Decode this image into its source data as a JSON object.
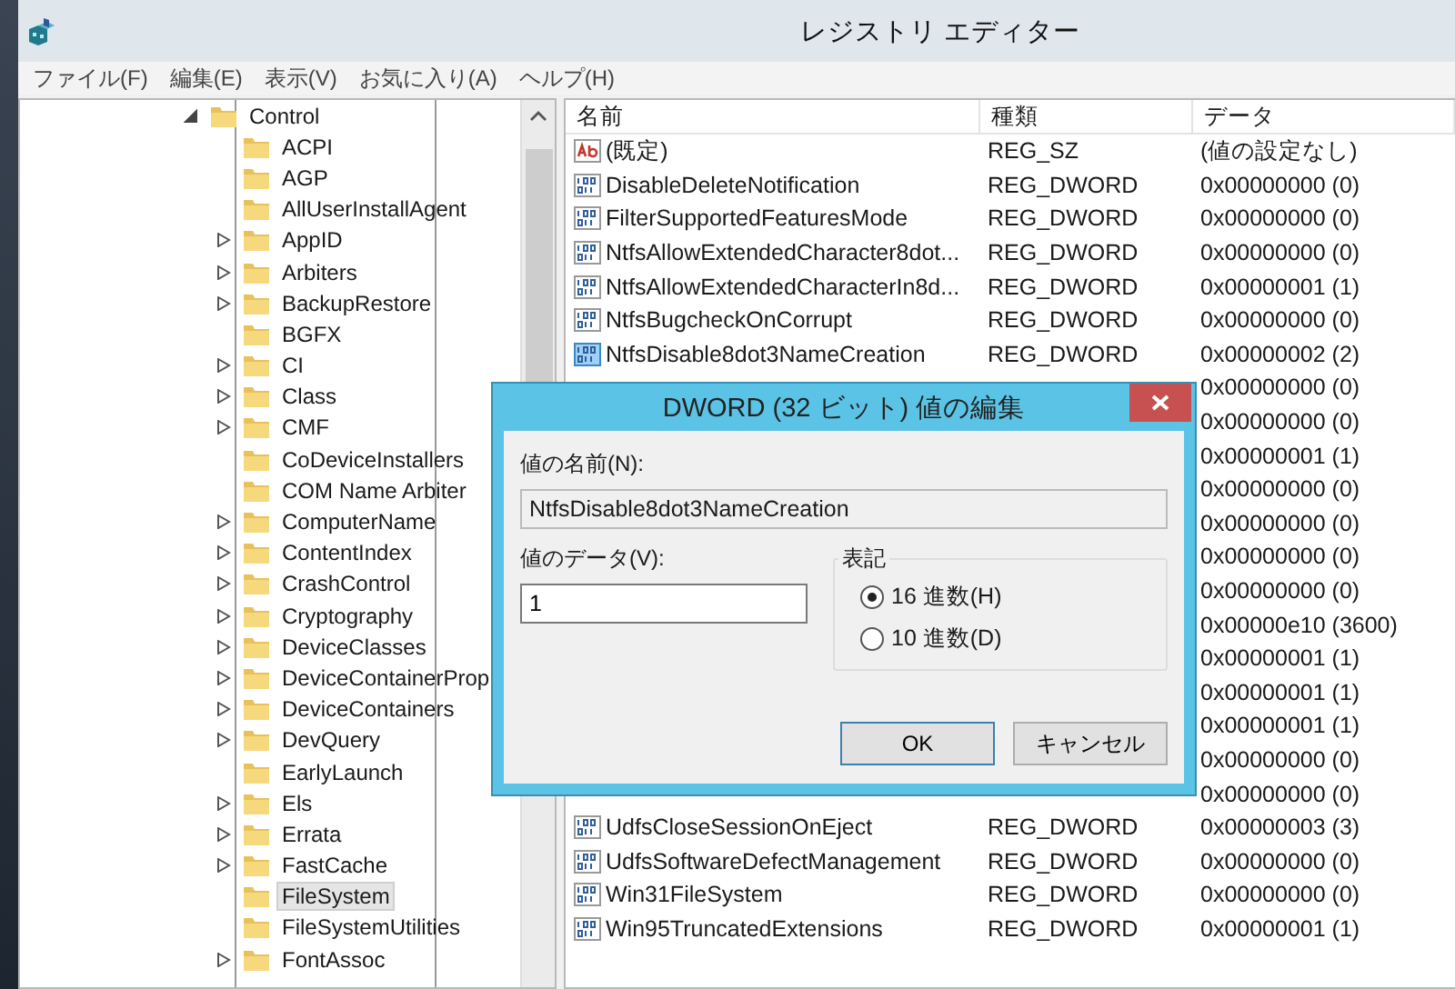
{
  "window": {
    "title": "レジストリ エディター"
  },
  "menu": [
    "ファイル(F)",
    "編集(E)",
    "表示(V)",
    "お気に入り(A)",
    "ヘルプ(H)"
  ],
  "tree": {
    "items": [
      {
        "label": "Control",
        "has_children": true,
        "expanded": true,
        "selected": false,
        "children": [
          {
            "label": "ACPI",
            "has_children": false,
            "expanded": false,
            "selected": false
          },
          {
            "label": "AGP",
            "has_children": false,
            "expanded": false,
            "selected": false
          },
          {
            "label": "AllUserInstallAgent",
            "has_children": false,
            "expanded": false,
            "selected": false
          },
          {
            "label": "AppID",
            "has_children": true,
            "expanded": false,
            "selected": false
          },
          {
            "label": "Arbiters",
            "has_children": true,
            "expanded": false,
            "selected": false
          },
          {
            "label": "BackupRestore",
            "has_children": true,
            "expanded": false,
            "selected": false
          },
          {
            "label": "BGFX",
            "has_children": false,
            "expanded": false,
            "selected": false
          },
          {
            "label": "CI",
            "has_children": true,
            "expanded": false,
            "selected": false
          },
          {
            "label": "Class",
            "has_children": true,
            "expanded": false,
            "selected": false
          },
          {
            "label": "CMF",
            "has_children": true,
            "expanded": false,
            "selected": false
          },
          {
            "label": "CoDeviceInstallers",
            "has_children": false,
            "expanded": false,
            "selected": false
          },
          {
            "label": "COM Name Arbiter",
            "has_children": false,
            "expanded": false,
            "selected": false
          },
          {
            "label": "ComputerName",
            "has_children": true,
            "expanded": false,
            "selected": false
          },
          {
            "label": "ContentIndex",
            "has_children": true,
            "expanded": false,
            "selected": false
          },
          {
            "label": "CrashControl",
            "has_children": true,
            "expanded": false,
            "selected": false
          },
          {
            "label": "Cryptography",
            "has_children": true,
            "expanded": false,
            "selected": false
          },
          {
            "label": "DeviceClasses",
            "has_children": true,
            "expanded": false,
            "selected": false
          },
          {
            "label": "DeviceContainerProp",
            "has_children": true,
            "expanded": false,
            "selected": false
          },
          {
            "label": "DeviceContainers",
            "has_children": true,
            "expanded": false,
            "selected": false
          },
          {
            "label": "DevQuery",
            "has_children": true,
            "expanded": false,
            "selected": false
          },
          {
            "label": "EarlyLaunch",
            "has_children": false,
            "expanded": false,
            "selected": false
          },
          {
            "label": "Els",
            "has_children": true,
            "expanded": false,
            "selected": false
          },
          {
            "label": "Errata",
            "has_children": true,
            "expanded": false,
            "selected": false
          },
          {
            "label": "FastCache",
            "has_children": true,
            "expanded": false,
            "selected": false
          },
          {
            "label": "FileSystem",
            "has_children": false,
            "expanded": false,
            "selected": true
          },
          {
            "label": "FileSystemUtilities",
            "has_children": false,
            "expanded": false,
            "selected": false
          },
          {
            "label": "FontAssoc",
            "has_children": true,
            "expanded": false,
            "selected": false
          }
        ]
      }
    ]
  },
  "table": {
    "columns": [
      "名前",
      "種類",
      "データ"
    ],
    "rows": [
      {
        "kind": "string",
        "name": "(既定)",
        "type": "REG_SZ",
        "data": "(値の設定なし)",
        "selected": false
      },
      {
        "kind": "dword",
        "name": "DisableDeleteNotification",
        "type": "REG_DWORD",
        "data": "0x00000000 (0)",
        "selected": false
      },
      {
        "kind": "dword",
        "name": "FilterSupportedFeaturesMode",
        "type": "REG_DWORD",
        "data": "0x00000000 (0)",
        "selected": false
      },
      {
        "kind": "dword",
        "name": "NtfsAllowExtendedCharacter8dot...",
        "type": "REG_DWORD",
        "data": "0x00000000 (0)",
        "selected": false
      },
      {
        "kind": "dword",
        "name": "NtfsAllowExtendedCharacterIn8d...",
        "type": "REG_DWORD",
        "data": "0x00000001 (1)",
        "selected": false
      },
      {
        "kind": "dword",
        "name": "NtfsBugcheckOnCorrupt",
        "type": "REG_DWORD",
        "data": "0x00000000 (0)",
        "selected": false
      },
      {
        "kind": "dword",
        "name": "NtfsDisable8dot3NameCreation",
        "type": "REG_DWORD",
        "data": "0x00000002 (2)",
        "selected": true
      },
      {
        "data": "0x00000000 (0)"
      },
      {
        "data": "0x00000000 (0)"
      },
      {
        "data": "0x00000001 (1)"
      },
      {
        "data": "0x00000000 (0)"
      },
      {
        "data": "0x00000000 (0)"
      },
      {
        "data": "0x00000000 (0)"
      },
      {
        "data": "0x00000000 (0)"
      },
      {
        "data": "0x00000e10 (3600)"
      },
      {
        "data": "0x00000001 (1)"
      },
      {
        "data": "0x00000001 (1)"
      },
      {
        "data": "0x00000001 (1)"
      },
      {
        "data": "0x00000000 (0)"
      },
      {
        "data": "0x00000000 (0)"
      },
      {
        "kind": "dword",
        "name": "UdfsCloseSessionOnEject",
        "type": "REG_DWORD",
        "data": "0x00000003 (3)",
        "selected": false
      },
      {
        "kind": "dword",
        "name": "UdfsSoftwareDefectManagement",
        "type": "REG_DWORD",
        "data": "0x00000000 (0)",
        "selected": false
      },
      {
        "kind": "dword",
        "name": "Win31FileSystem",
        "type": "REG_DWORD",
        "data": "0x00000000 (0)",
        "selected": false
      },
      {
        "kind": "dword",
        "name": "Win95TruncatedExtensions",
        "type": "REG_DWORD",
        "data": "0x00000001 (1)",
        "selected": false
      }
    ]
  },
  "dialog": {
    "title": "DWORD (32 ビット) 値の編集",
    "name_label": "値の名前(N):",
    "name_value": "NtfsDisable8dot3NameCreation",
    "data_label": "値のデータ(V):",
    "data_value": "1",
    "group_label": "表記",
    "radios": [
      {
        "label": "16 進数(H)",
        "selected": true
      },
      {
        "label": "10 進数(D)",
        "selected": false
      }
    ],
    "buttons": [
      "OK",
      "キャンセル"
    ]
  }
}
